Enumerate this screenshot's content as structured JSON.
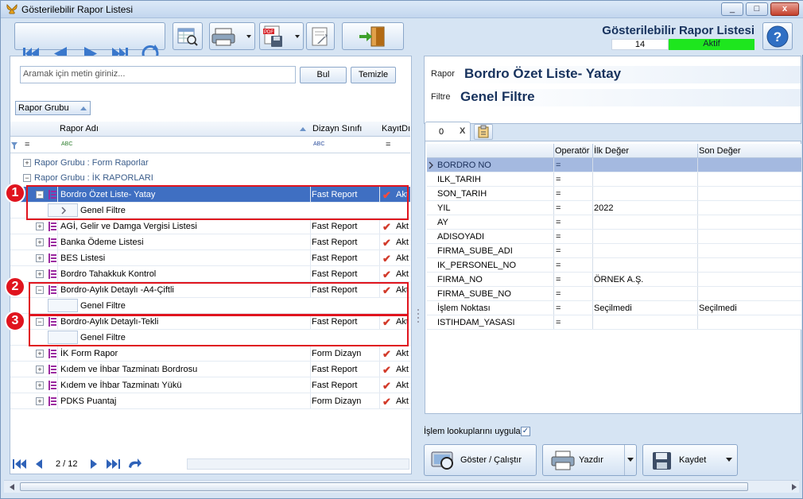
{
  "window": {
    "title": "Gösterilebilir Rapor Listesi",
    "min": "_",
    "max": "□",
    "close": "x"
  },
  "header": {
    "title": "Gösterilebilir Rapor Listesi",
    "count": "14",
    "status": "Aktif",
    "status_color": "#1ee61e"
  },
  "search": {
    "placeholder": "Aramak için metin giriniz...",
    "find_label": "Bul",
    "clear_label": "Temizle"
  },
  "group_chip": "Rapor Grubu",
  "grid": {
    "columns": {
      "name": "Rapor Adı",
      "design": "Dizayn Sınıfı",
      "saved": "KayıtDı"
    },
    "filter_eq": "=",
    "groups": [
      {
        "label": "Rapor Grubu : Form Raporlar",
        "expander": "+"
      },
      {
        "label": "Rapor Grubu : İK RAPORLARI",
        "expander": "−"
      }
    ],
    "rows": [
      {
        "name": "Bordro Özet Liste- Yatay",
        "design": "Fast Report",
        "saved": "Akt",
        "expander": "−",
        "sub": "Genel Filtre"
      },
      {
        "name": "AGİ, Gelir ve Damga Vergisi Listesi",
        "design": "Fast Report",
        "saved": "Akt",
        "expander": "+"
      },
      {
        "name": "Banka Ödeme Listesi",
        "design": "Fast Report",
        "saved": "Akt",
        "expander": "+"
      },
      {
        "name": "BES Listesi",
        "design": "Fast Report",
        "saved": "Akt",
        "expander": "+"
      },
      {
        "name": "Bordro Tahakkuk Kontrol",
        "design": "Fast Report",
        "saved": "Akt",
        "expander": "+"
      },
      {
        "name": "Bordro-Aylık Detaylı -A4-Çiftli",
        "design": "Fast Report",
        "saved": "Akt",
        "expander": "−",
        "sub": "Genel Filtre"
      },
      {
        "name": "Bordro-Aylık Detaylı-Tekli",
        "design": "Fast Report",
        "saved": "Akt",
        "expander": "−",
        "sub": "Genel Filtre"
      },
      {
        "name": "İK Form Rapor",
        "design": "Form Dizayn",
        "saved": "Akt",
        "expander": "+"
      },
      {
        "name": "Kıdem ve İhbar Tazminatı Bordrosu",
        "design": "Fast Report",
        "saved": "Akt",
        "expander": "+"
      },
      {
        "name": "Kıdem ve İhbar Tazminatı Yükü",
        "design": "Fast Report",
        "saved": "Akt",
        "expander": "+"
      },
      {
        "name": "PDKS Puantaj",
        "design": "Form Dizayn",
        "saved": "Akt",
        "expander": "+"
      }
    ]
  },
  "annotations": [
    "1",
    "2",
    "3"
  ],
  "pager": {
    "text": "2 / 12"
  },
  "right": {
    "report_label": "Rapor",
    "report_value": "Bordro Özet Liste- Yatay",
    "filter_label": "Filtre",
    "filter_value": "Genel Filtre",
    "tab": "0",
    "tab_close": "X",
    "param_columns": {
      "op": "Operatör",
      "first": "İlk Değer",
      "last": "Son Değer"
    },
    "params": [
      {
        "name": "BORDRO NO",
        "op": "=",
        "first": "",
        "last": ""
      },
      {
        "name": "ILK_TARIH",
        "op": "=",
        "first": "",
        "last": ""
      },
      {
        "name": "SON_TARIH",
        "op": "=",
        "first": "",
        "last": ""
      },
      {
        "name": "YIL",
        "op": "=",
        "first": "2022",
        "last": ""
      },
      {
        "name": "AY",
        "op": "=",
        "first": "",
        "last": ""
      },
      {
        "name": "ADISOYADI",
        "op": "=",
        "first": "",
        "last": ""
      },
      {
        "name": "FIRMA_SUBE_ADI",
        "op": "=",
        "first": "",
        "last": ""
      },
      {
        "name": "IK_PERSONEL_NO",
        "op": "=",
        "first": "",
        "last": ""
      },
      {
        "name": "FIRMA_NO",
        "op": "=",
        "first": "ÖRNEK A.Ş.",
        "last": ""
      },
      {
        "name": "FIRMA_SUBE_NO",
        "op": "=",
        "first": "",
        "last": ""
      },
      {
        "name": "İşlem Noktası",
        "op": "=",
        "first": "Seçilmedi",
        "last": "Seçilmedi"
      },
      {
        "name": "ISTIHDAM_YASASI",
        "op": "=",
        "first": "",
        "last": ""
      }
    ],
    "lookup_label": "İşlem lookuplarını uygula",
    "buttons": {
      "show": "Göster / Çalıştır",
      "print": "Yazdır",
      "save": "Kaydet"
    }
  }
}
